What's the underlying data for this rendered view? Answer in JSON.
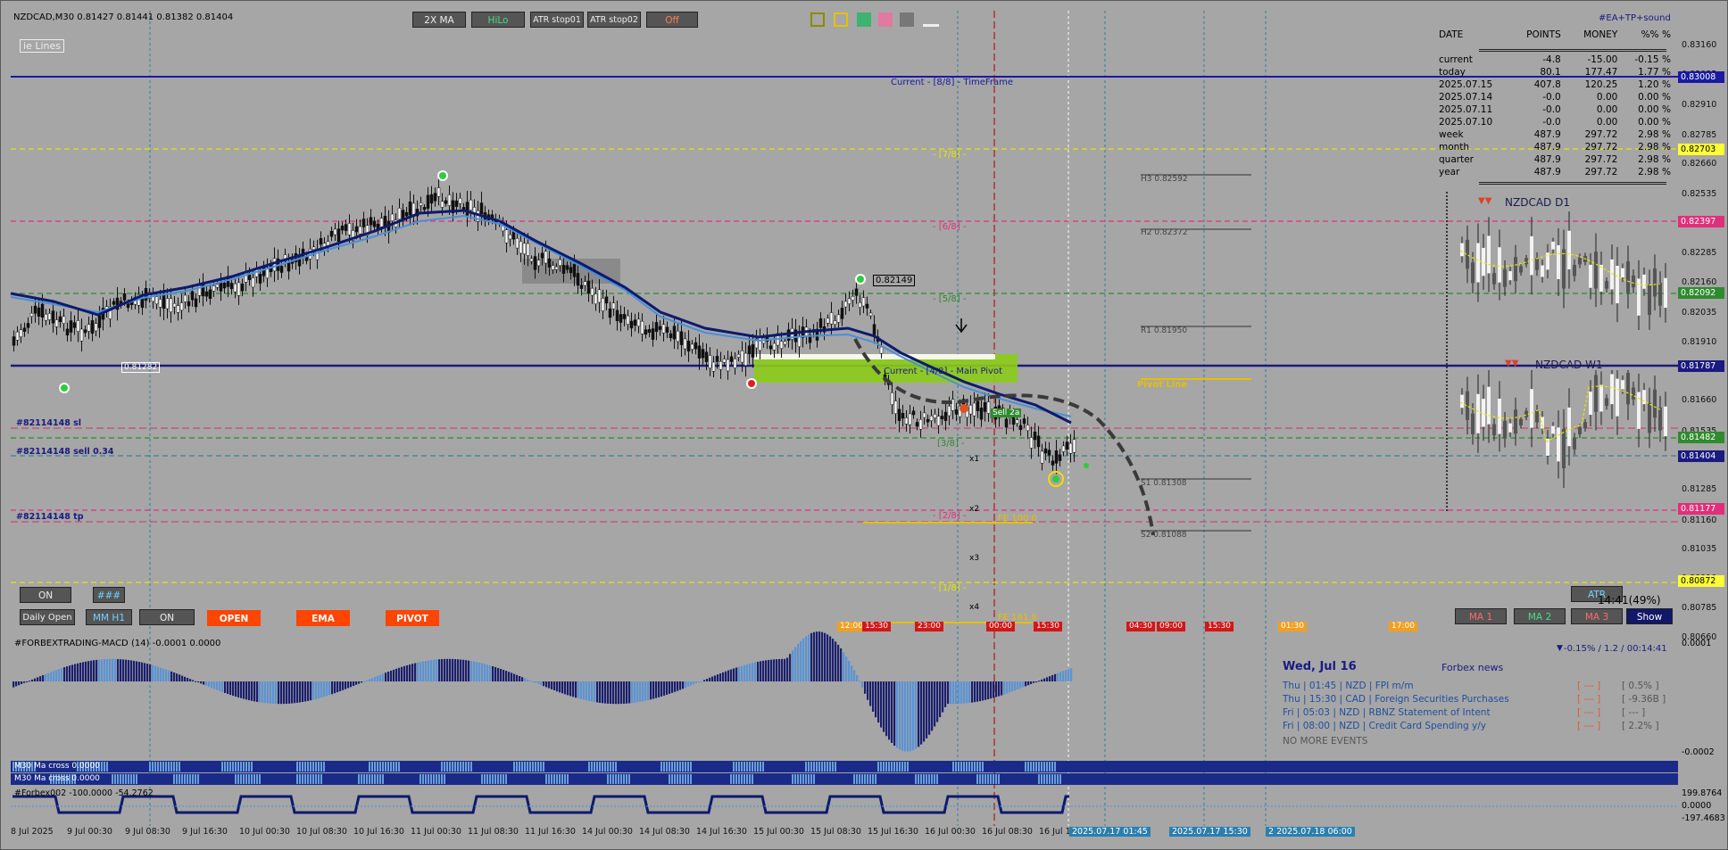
{
  "header": {
    "symbol_line": "NZDCAD,M30  0.81427 0.81441 0.81382 0.81404",
    "ea_label": "#EA+TP+sound"
  },
  "toolbar": {
    "btn_2xma": "2X MA",
    "btn_hilo": "HiLo",
    "btn_atr1": "ATR stop01",
    "btn_atr2": "ATR stop02",
    "btn_off": "Off"
  },
  "left_tag": "ie Lines",
  "levels": {
    "current_tf": "Current - [8/8] - TimeFrame",
    "l78": "- [7/8] -",
    "l68": "- [6/8] -",
    "l58": "- [5/8] -",
    "main_pivot": "Current - [4/8] - Main Pivot",
    "l38": "[3/8] -",
    "l28": "- [2/8] -",
    "l18": "- [1/8] -",
    "h3": "H3 0.82592",
    "h2": "H2 0.82372",
    "r1": "R1 0.81950",
    "pivot_line": "Pivot Line",
    "s1": "S1 0.81308",
    "s2": "S2 0.81088",
    "fe100": "FE 100.0",
    "fe161": "FE 161.8",
    "x1": "x1",
    "x2": "x2",
    "x3": "x3",
    "x4": "x4",
    "peak": "0.82149",
    "low_lbl": "0.81282",
    "sell_lbl": "Sell 2a"
  },
  "orders": {
    "sl": "#82114148 sl",
    "sell": "#82114148 sell 0.34",
    "tp": "#82114148 tp"
  },
  "stats": {
    "headers": [
      "DATE",
      "POINTS",
      "MONEY",
      "%%",
      "%"
    ],
    "rows": [
      [
        "current",
        "-4.8",
        "-15.00",
        "-0.15",
        "%"
      ],
      [
        "today",
        "80.1",
        "177.47",
        "1.77",
        "%"
      ],
      [
        "2025.07.15",
        "407.8",
        "120.25",
        "1.20",
        "%"
      ],
      [
        "2025.07.14",
        "-0.0",
        "0.00",
        "0.00",
        "%"
      ],
      [
        "2025.07.11",
        "-0.0",
        "0.00",
        "0.00",
        "%"
      ],
      [
        "2025.07.10",
        "-0.0",
        "0.00",
        "0.00",
        "%"
      ],
      [
        "week",
        "487.9",
        "297.72",
        "2.98",
        "%"
      ],
      [
        "month",
        "487.9",
        "297.72",
        "2.98",
        "%"
      ],
      [
        "quarter",
        "487.9",
        "297.72",
        "2.98",
        "%"
      ],
      [
        "year",
        "487.9",
        "297.72",
        "2.98",
        "%"
      ]
    ]
  },
  "mini": {
    "d1": "NZDCAD D1",
    "w1": "NZDCAD W1"
  },
  "bottom_buttons": {
    "on1": "ON",
    "hash": "###",
    "daily_open": "Daily Open",
    "mm_h1": "MM H1",
    "on2": "ON",
    "open": "OPEN",
    "ema": "EMA",
    "pivot": "PIVOT",
    "atr": "ATR",
    "timer": "14:41(49%)",
    "ma1": "MA 1",
    "ma2": "MA 2",
    "ma3": "MA 3",
    "show": "Show"
  },
  "time_tags": [
    "12:00",
    "15:30",
    "23:00",
    "00:00",
    "15:30",
    "04:30",
    "09:00",
    "15:30",
    "01:30",
    "17:00"
  ],
  "price_axis": {
    "ticks": [
      "0.83160",
      "0.83035",
      "0.82910",
      "0.82785",
      "0.82660",
      "0.82535",
      "0.82410",
      "0.82285",
      "0.82160",
      "0.82035",
      "0.81910",
      "0.81660",
      "0.81535",
      "0.81285",
      "0.81160",
      "0.81035",
      "0.80910",
      "0.80785",
      "0.80660"
    ],
    "badges": [
      {
        "v": "0.83008",
        "bg": "#1a1aa0",
        "fg": "#ffffff"
      },
      {
        "v": "0.82703",
        "bg": "#ffff33",
        "fg": "#000000"
      },
      {
        "v": "0.82397",
        "bg": "#e0307a",
        "fg": "#ffffff"
      },
      {
        "v": "0.82092",
        "bg": "#2e8b2e",
        "fg": "#ffffff"
      },
      {
        "v": "0.81787",
        "bg": "#1a1a80",
        "fg": "#ffffff"
      },
      {
        "v": "0.81482",
        "bg": "#2e8b2e",
        "fg": "#ffffff"
      },
      {
        "v": "0.81404",
        "bg": "#1a1a80",
        "fg": "#ffffff"
      },
      {
        "v": "0.81177",
        "bg": "#e0307a",
        "fg": "#ffffff"
      },
      {
        "v": "0.80872",
        "bg": "#ffff33",
        "fg": "#000000"
      }
    ]
  },
  "macd": {
    "label": "#FORBEXTRADING-MACD (14) -0.0001 0.0000",
    "top": "0.0001",
    "bottom": "-0.0002",
    "info": "-0.15% / 1.2 / 00:14:41"
  },
  "news": {
    "date": "Wed, Jul 16",
    "source": "Forbex news",
    "items": [
      {
        "text": "Thu | 01:45 | NZD | FPI m/m",
        "fc": "[ --- ]",
        "val": "[ 0.5% ]"
      },
      {
        "text": "Thu | 15:30 | CAD | Foreign Securities Purchases",
        "fc": "[ --- ]",
        "val": "[ -9.36B ]"
      },
      {
        "text": "Fri | 05:03 | NZD | RBNZ Statement of Intent",
        "fc": "[ --- ]",
        "val": "[ --- ]"
      },
      {
        "text": "Fri | 08:00 | NZD | Credit Card Spending y/y",
        "fc": "[ --- ]",
        "val": "[ 2.2% ]"
      }
    ],
    "end": "NO MORE EVENTS"
  },
  "strip": {
    "l1": "M30 Ma cross 0.0000",
    "l2": "M30 Ma cross 0.0000"
  },
  "ind": {
    "label": "#Forbex002 -100.0000 -54.2762",
    "top": "199.8764",
    "mid": "0.0000",
    "bottom": "-197.4683"
  },
  "dates": [
    "8 Jul 2025",
    "9 Jul 00:30",
    "9 Jul 08:30",
    "9 Jul 16:30",
    "10 Jul 00:30",
    "10 Jul 08:30",
    "10 Jul 16:30",
    "11 Jul 00:30",
    "11 Jul 08:30",
    "11 Jul 16:30",
    "14 Jul 00:30",
    "14 Jul 08:30",
    "14 Jul 16:30",
    "15 Jul 00:30",
    "15 Jul 08:30",
    "15 Jul 16:30",
    "16 Jul 00:30",
    "16 Jul 08:30",
    "16 Jul 1"
  ],
  "date_tags": [
    "2025.07.17 01:45",
    "2025.07.17 15:30",
    "2 2025.07.18 06:00"
  ]
}
